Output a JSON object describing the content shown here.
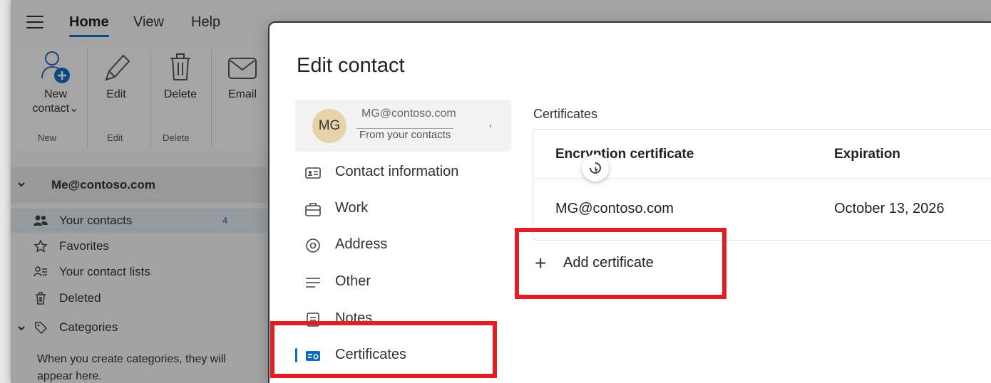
{
  "menu": {
    "tabs": [
      {
        "label": "Home",
        "active": true
      },
      {
        "label": "View",
        "active": false
      },
      {
        "label": "Help",
        "active": false
      }
    ]
  },
  "ribbon": {
    "new_contact": {
      "label_line1": "New",
      "label_line2": "contact",
      "icon": "add-person-icon"
    },
    "edit": {
      "label": "Edit",
      "icon": "pencil-icon"
    },
    "delete": {
      "label": "Delete",
      "icon": "trash-icon"
    },
    "email": {
      "label": "Email",
      "icon": "envelope-icon"
    },
    "groups": [
      "New",
      "Edit",
      "Delete"
    ]
  },
  "nav": {
    "account": "Me@contoso.com",
    "items": [
      {
        "label": "Your contacts",
        "icon": "people-icon",
        "count": "4",
        "selected": true
      },
      {
        "label": "Favorites",
        "icon": "star-icon"
      },
      {
        "label": "Your contact lists",
        "icon": "contact-list-icon"
      },
      {
        "label": "Deleted",
        "icon": "trash-icon"
      },
      {
        "label": "Categories",
        "icon": "tag-icon"
      }
    ],
    "categories_hint": "When you create categories, they will appear here."
  },
  "dialog": {
    "title": "Edit contact",
    "contact_card": {
      "initials": "MG",
      "email": "MG@contoso.com",
      "source": "From your contacts"
    },
    "sections": [
      {
        "label": "Contact information",
        "icon": "contact-card-icon"
      },
      {
        "label": "Work",
        "icon": "briefcase-icon"
      },
      {
        "label": "Address",
        "icon": "location-icon"
      },
      {
        "label": "Other",
        "icon": "lines-icon"
      },
      {
        "label": "Notes",
        "icon": "note-icon"
      },
      {
        "label": "Certificates",
        "icon": "certificate-icon",
        "selected": true
      }
    ],
    "certificates": {
      "heading": "Certificates",
      "col_certificate": "Encryption certificate",
      "col_expiration": "Expiration",
      "rows": [
        {
          "certificate": "MG@contoso.com",
          "expiration": "October 13, 2026"
        }
      ],
      "add_label": "Add certificate"
    }
  },
  "colors": {
    "accent": "#0f6cbd",
    "highlight": "#e01e26",
    "avatar": "#e6d3a7"
  }
}
